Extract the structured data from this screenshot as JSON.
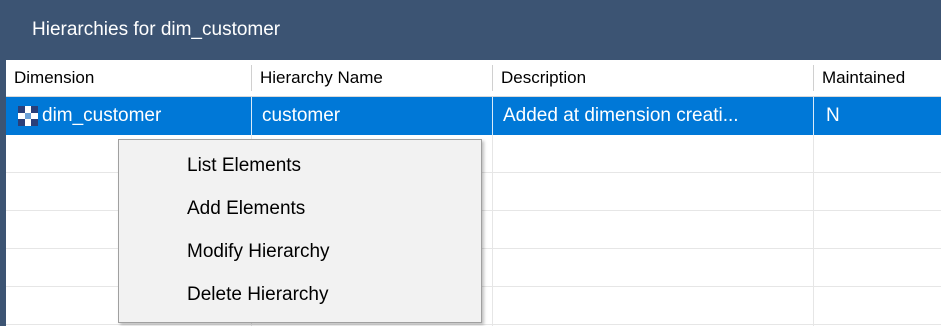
{
  "window": {
    "title": "Hierarchies for dim_customer"
  },
  "columns": [
    "Dimension",
    "Hierarchy Name",
    "Description",
    "Maintained"
  ],
  "rows": [
    {
      "dimension": "dim_customer",
      "hierarchy_name": "customer",
      "description": "Added at dimension creati...",
      "maintained": "N",
      "selected": true
    }
  ],
  "context_menu": {
    "items": [
      "List Elements",
      "Add Elements",
      "Modify Hierarchy",
      "Delete Hierarchy"
    ]
  },
  "colors": {
    "titlebar": "#3c5473",
    "selection": "#0078d7",
    "menu_bg": "#f2f2f2"
  },
  "icons": {
    "dimension_row": "dimension-grid-icon"
  }
}
